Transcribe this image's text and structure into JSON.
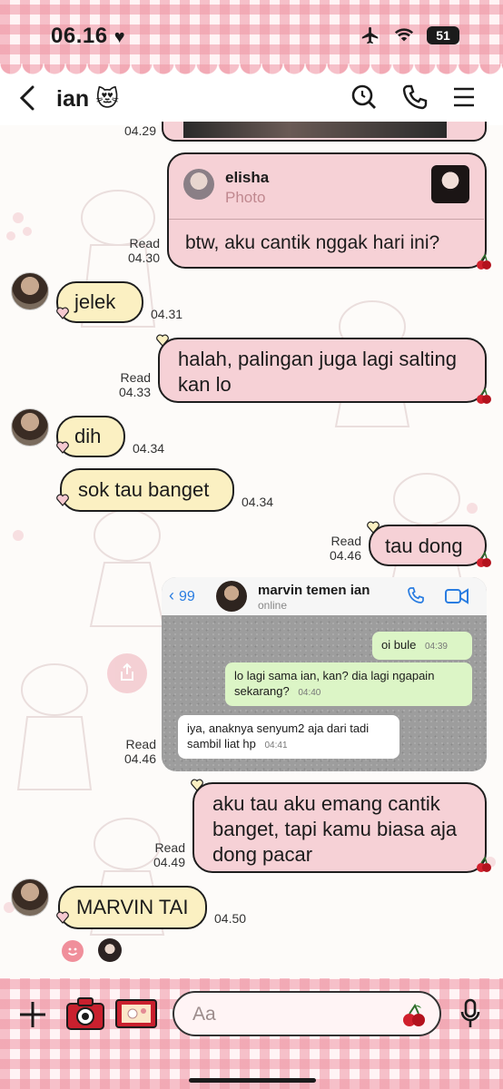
{
  "status_bar": {
    "time": "06.16",
    "battery": "51"
  },
  "header": {
    "contact_name": "ian"
  },
  "reply_preview": {
    "author": "elisha",
    "kind": "Photo"
  },
  "messages": [
    {
      "id": "m0",
      "side": "out",
      "text": "",
      "read": "",
      "time": "04.29"
    },
    {
      "id": "m1",
      "side": "out",
      "text": "btw, aku cantik nggak hari ini?",
      "read": "Read",
      "time": "04.30"
    },
    {
      "id": "m2",
      "side": "in",
      "text": "jelek",
      "time": "04.31"
    },
    {
      "id": "m3",
      "side": "out",
      "text": "halah, palingan juga lagi salting kan lo",
      "read": "Read",
      "time": "04.33"
    },
    {
      "id": "m4",
      "side": "in",
      "text": "dih",
      "time": "04.34"
    },
    {
      "id": "m5",
      "side": "in",
      "text": "sok tau banget",
      "time": "04.34"
    },
    {
      "id": "m6",
      "side": "out",
      "text": "tau dong",
      "read": "Read",
      "time": "04.46"
    },
    {
      "id": "m7",
      "side": "out",
      "text": "",
      "read": "Read",
      "time": "04.46"
    },
    {
      "id": "m8",
      "side": "out",
      "text": "aku tau aku emang cantik banget, tapi kamu biasa aja dong pacar",
      "read": "Read",
      "time": "04.49"
    },
    {
      "id": "m9",
      "side": "in",
      "text": "MARVIN TAI",
      "time": "04.50"
    }
  ],
  "whatsapp_screenshot": {
    "back_count": "99",
    "contact_name": "marvin temen ian",
    "status": "online",
    "messages": [
      {
        "side": "out",
        "text": "oi bule",
        "time": "04:39"
      },
      {
        "side": "out",
        "text": "lo lagi sama ian, kan? dia lagi ngapain sekarang?",
        "time": "04:40"
      },
      {
        "side": "in",
        "text": "iya, anaknya senyum2 aja dari tadi sambil liat hp",
        "time": "04:41"
      }
    ]
  },
  "input": {
    "placeholder": "Aa"
  },
  "colors": {
    "incoming_bubble": "#fbf0c2",
    "outgoing_bubble": "#f6d1d6",
    "gingham": "#ee96a5"
  },
  "icons": [
    "back-icon",
    "search-icon",
    "phone-icon",
    "menu-icon",
    "plus-icon",
    "camera-icon",
    "sticker-icon",
    "cherry-icon",
    "mic-icon",
    "share-icon",
    "smile-icon",
    "heart-icon"
  ]
}
